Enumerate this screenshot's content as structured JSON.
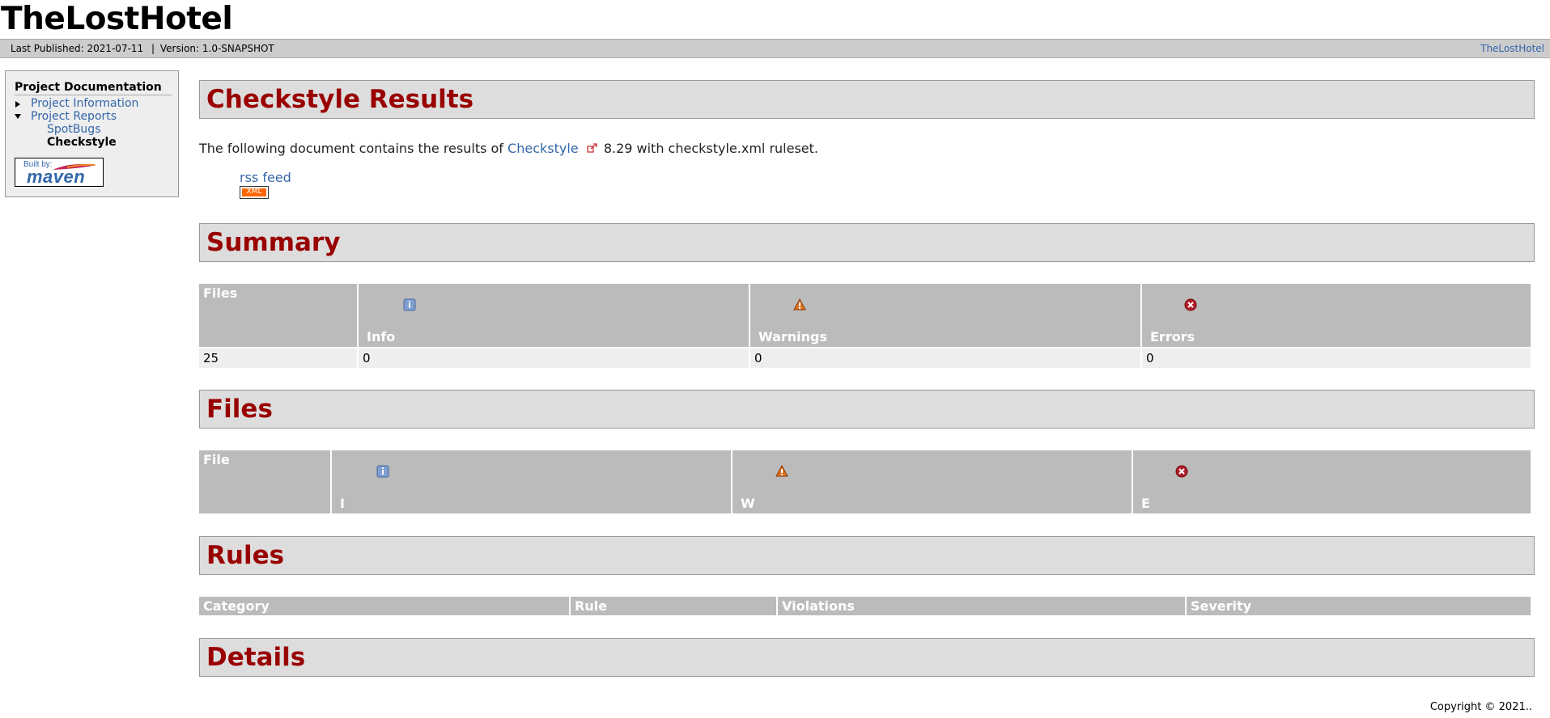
{
  "site": {
    "name": "TheLostHotel"
  },
  "breadcrumbs": {
    "published": "Last Published: 2021-07-11",
    "separator": "|",
    "version": "Version: 1.0-SNAPSHOT",
    "right_link": "TheLostHotel"
  },
  "nav": {
    "heading": "Project Documentation",
    "items": [
      {
        "label": "Project Information",
        "state": "collapsed"
      },
      {
        "label": "Project Reports",
        "state": "expanded"
      },
      {
        "label": "SpotBugs",
        "state": "link"
      },
      {
        "label": "Checkstyle",
        "state": "current"
      }
    ],
    "powered_by": {
      "builtby": "Built by:",
      "logo": "maven"
    }
  },
  "main": {
    "title": "Checkstyle Results",
    "intro_prefix": "The following document contains the results of",
    "intro_link": "Checkstyle",
    "intro_suffix": "8.29 with checkstyle.xml ruleset.",
    "rss_label": "rss feed",
    "rss_badge": "XML",
    "summary": {
      "heading": "Summary",
      "headers": [
        "Files",
        "Info",
        "Warnings",
        "Errors"
      ],
      "row": [
        "25",
        "0",
        "0",
        "0"
      ]
    },
    "files": {
      "heading": "Files",
      "headers": [
        "File",
        "I",
        "W",
        "E"
      ]
    },
    "rules": {
      "heading": "Rules",
      "headers": [
        "Category",
        "Rule",
        "Violations",
        "Severity"
      ]
    },
    "details": {
      "heading": "Details"
    }
  },
  "footer": {
    "copyright": "Copyright © 2021.."
  },
  "icons": {
    "info": "info-icon",
    "warning": "warning-icon",
    "error": "error-icon",
    "external": "external-link-icon"
  },
  "colors": {
    "heading_red": "#990000",
    "link_blue": "#3366aa",
    "header_grey": "#bbbbbb",
    "section_bg": "#dddddd"
  }
}
